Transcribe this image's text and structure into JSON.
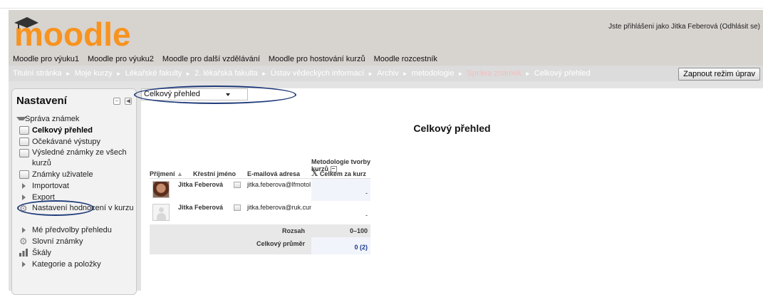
{
  "header": {
    "logo_text": "moodle",
    "login_text": "Jste přihlášeni jako Jitka Feberová (Odhlásit se)"
  },
  "custom_menu": [
    "Moodle pro výuku1",
    "Moodle pro výuku2",
    "Moodle pro další vzdělávání",
    "Moodle pro hostování kurzů",
    "Moodle rozcestník"
  ],
  "breadcrumb": [
    "Titulní stránka",
    "Moje kurzy",
    "Lékařské fakulty",
    "2. lékařská fakulta",
    "Ústav vědeckých informací",
    "Archiv",
    "metodologie",
    "Správa známek",
    "Celkový přehled"
  ],
  "edit_button": "Zapnout režim úprav",
  "settings_block": {
    "title": "Nastavení",
    "items": {
      "grade_admin": "Správa známek",
      "grader_report": "Celkový přehled",
      "outcomes": "Očekávané výstupy",
      "overview": "Výsledné známky ze všech kurzů",
      "user_report": "Známky uživatele",
      "import": "Importovat",
      "export": "Export",
      "course_grade_settings": "Nastavení hodnocení v kurzu",
      "my_preferences": "Mé předvolby přehledu",
      "letters": "Slovní známky",
      "scales": "Škály",
      "categories": "Kategorie a položky"
    }
  },
  "report_select": "Celkový přehled",
  "page_title": "Celkový přehled",
  "grade_table": {
    "col_surname": "Příjmení",
    "col_firstname": "Křestní jméno",
    "col_email": "E-mailová adresa",
    "col_course": "Metodologie tvorby kurzů",
    "col_total": "Celkem za kurz",
    "students": [
      {
        "name": "Jitka Feberová",
        "email": "jitka.feberova@lfmotol.cuni.cz",
        "grade": "-"
      },
      {
        "name": "Jitka Feberová",
        "email": "jitka.feberova@ruk.cuni.cz",
        "grade": "-"
      }
    ],
    "range_label": "Rozsah",
    "range_value": "0–100",
    "average_label": "Celkový průměr",
    "average_value": "0 (2)"
  }
}
